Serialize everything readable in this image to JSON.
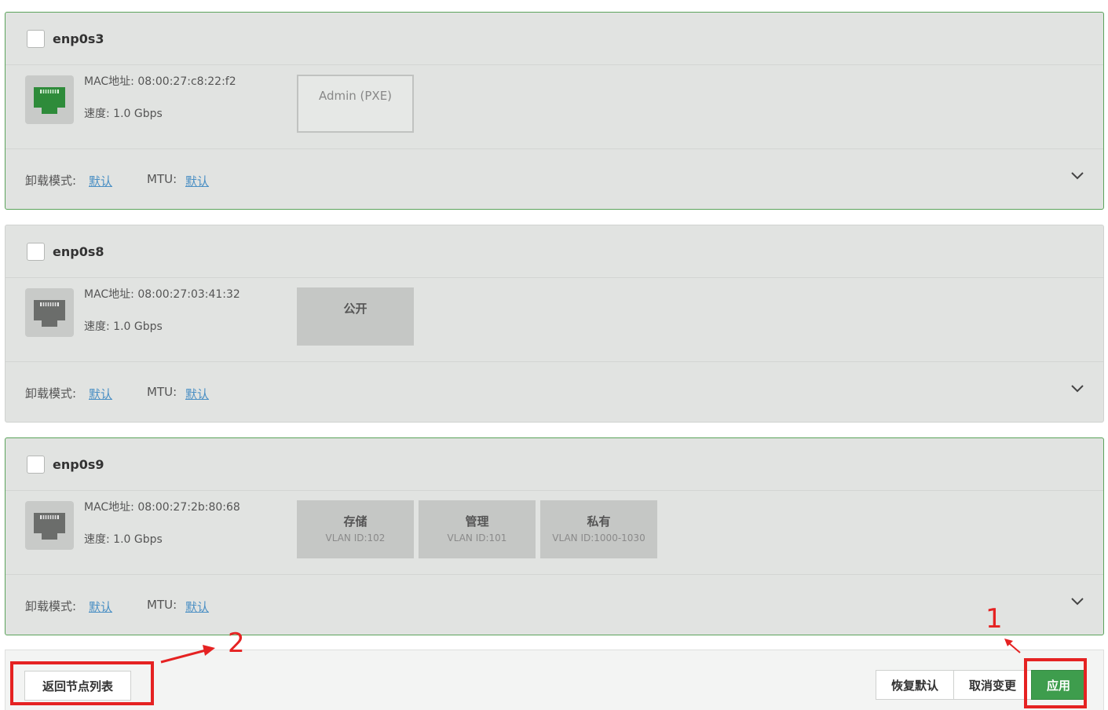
{
  "interfaces": [
    {
      "name": "enp0s3",
      "mac": "MAC地址: 08:00:27:c8:22:f2",
      "speed": "速度: 1.0 Gbps",
      "icon": "ethernet-port-icon-green",
      "icon_color": "#2e8b3a",
      "networks": [
        {
          "name": "Admin (PXE)"
        }
      ],
      "offload_label": "卸载模式:",
      "offload_value": "默认",
      "mtu_label": "MTU:",
      "mtu_value": "默认"
    },
    {
      "name": "enp0s8",
      "mac": "MAC地址: 08:00:27:03:41:32",
      "speed": "速度: 1.0 Gbps",
      "icon": "ethernet-port-icon-gray",
      "icon_color": "#6b6d6b",
      "networks": [
        {
          "name": "公开"
        }
      ],
      "offload_label": "卸载模式:",
      "offload_value": "默认",
      "mtu_label": "MTU:",
      "mtu_value": "默认"
    },
    {
      "name": "enp0s9",
      "mac": "MAC地址: 08:00:27:2b:80:68",
      "speed": "速度: 1.0 Gbps",
      "icon": "ethernet-port-icon-gray",
      "icon_color": "#6b6d6b",
      "networks": [
        {
          "name": "存储",
          "vlan": "VLAN ID:102"
        },
        {
          "name": "管理",
          "vlan": "VLAN ID:101"
        },
        {
          "name": "私有",
          "vlan": "VLAN ID:1000-1030"
        }
      ],
      "offload_label": "卸载模式:",
      "offload_value": "默认",
      "mtu_label": "MTU:",
      "mtu_value": "默认"
    }
  ],
  "toolbar": {
    "back_label": "返回节点列表",
    "reset_label": "恢复默认",
    "cancel_label": "取消变更",
    "apply_label": "应用"
  },
  "annotations": {
    "marker_1": "1",
    "marker_2": "2",
    "color": "#e52222"
  },
  "colors": {
    "accent_green": "#3e9d4d",
    "link_blue": "#4a8fc4",
    "panel_gray": "#e1e3e1"
  }
}
